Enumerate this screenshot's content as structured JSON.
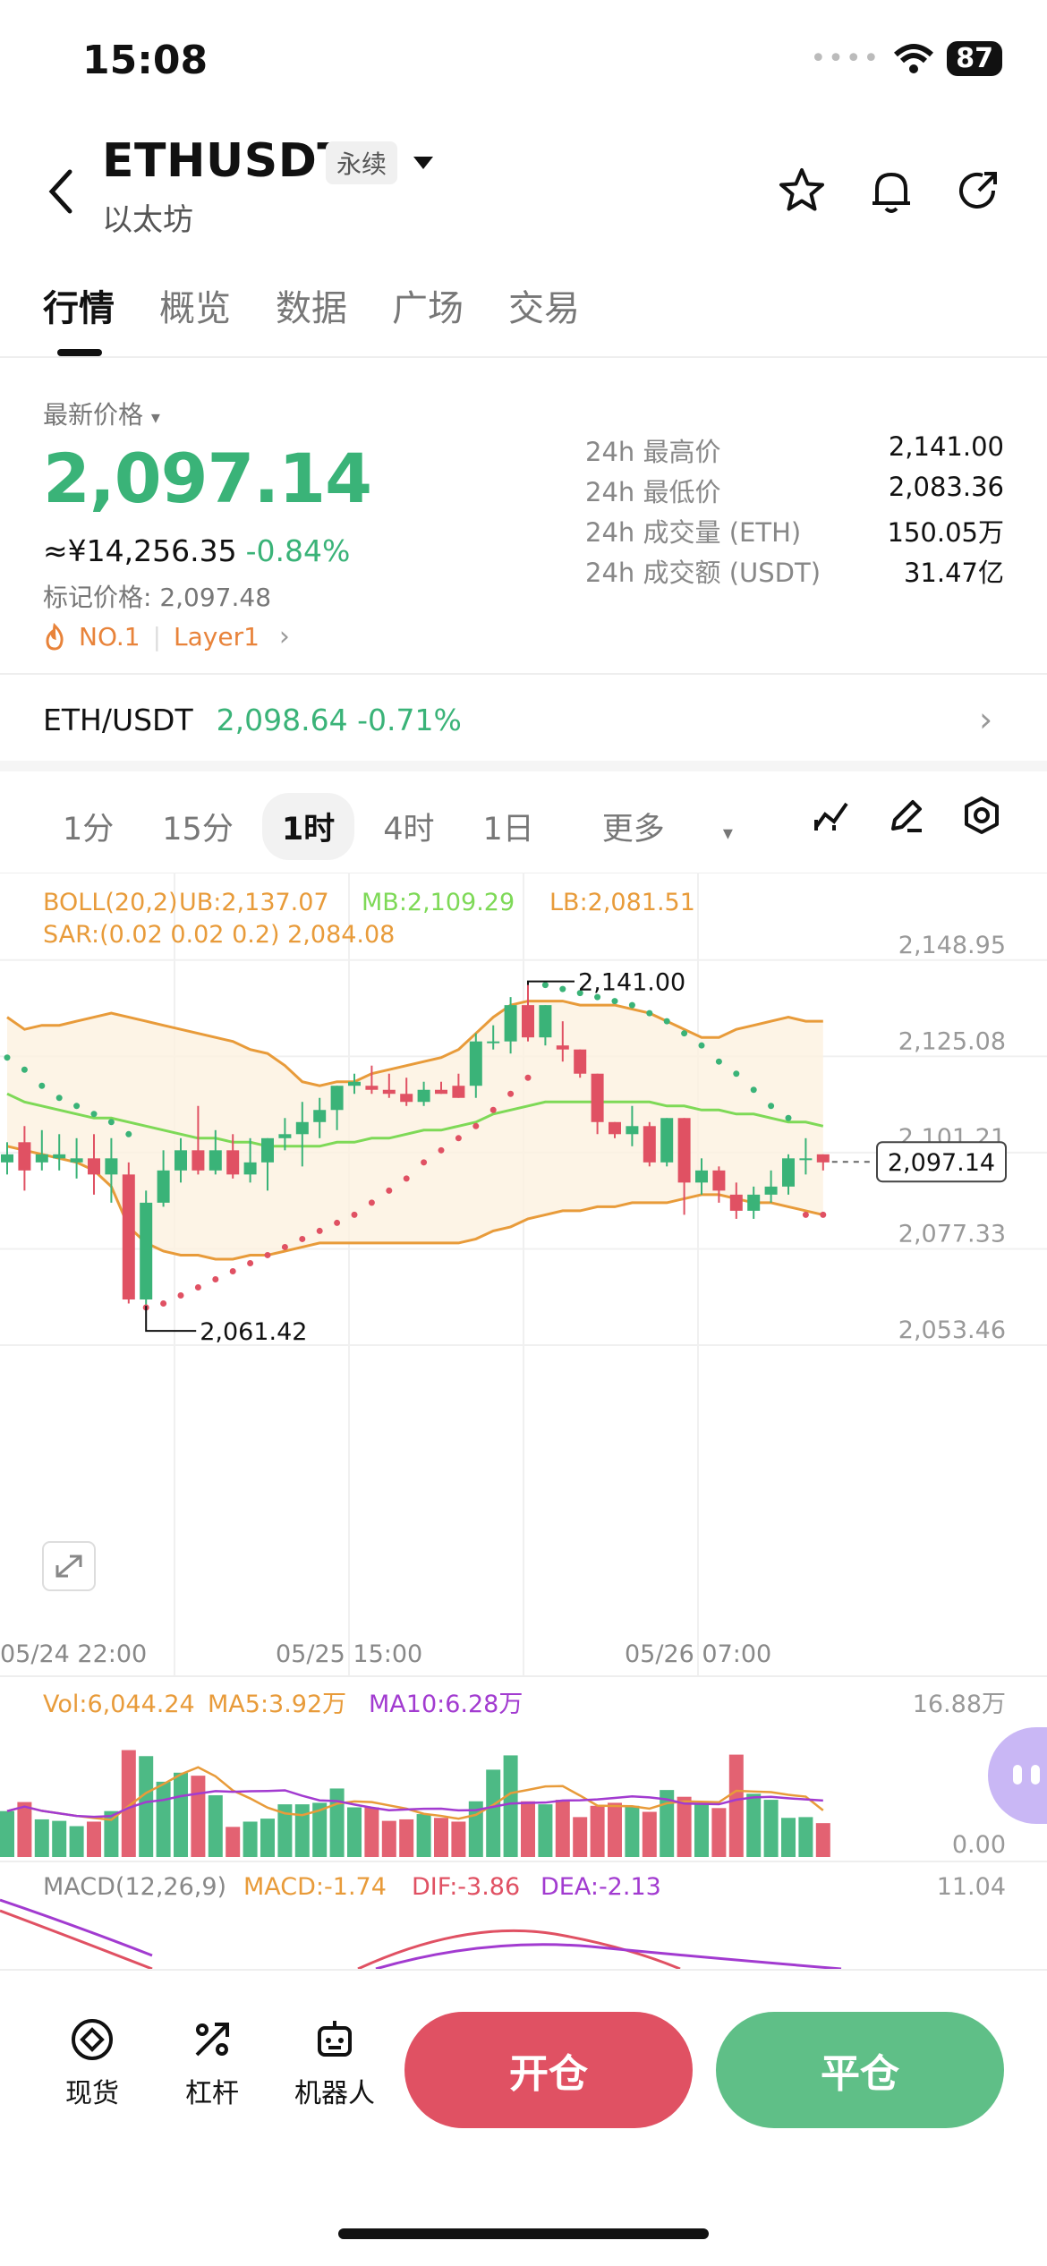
{
  "status": {
    "time": "15:08",
    "battery": "87"
  },
  "header": {
    "symbol": "ETHUSDT",
    "tag": "永续",
    "name": "以太坊"
  },
  "tabs": [
    {
      "label": "行情",
      "active": true
    },
    {
      "label": "概览",
      "active": false
    },
    {
      "label": "数据",
      "active": false
    },
    {
      "label": "广场",
      "active": false
    },
    {
      "label": "交易",
      "active": false
    }
  ],
  "price": {
    "label": "最新价格",
    "last": "2,097.14",
    "cny": "≈¥14,256.35",
    "change_pct": "-0.84%",
    "mark": "标记价格: 2,097.48",
    "rank": "NO.1",
    "category": "Layer1"
  },
  "stats": [
    {
      "k": "24h 最高价",
      "v": "2,141.00"
    },
    {
      "k": "24h 最低价",
      "v": "2,083.36"
    },
    {
      "k": "24h 成交量 (ETH)",
      "v": "150.05万"
    },
    {
      "k": "24h 成交额 (USDT)",
      "v": "31.47亿"
    }
  ],
  "spot_pair": {
    "name": "ETH/USDT",
    "price": "2,098.64",
    "change": "-0.71%"
  },
  "timeframes": [
    {
      "label": "1分",
      "active": false
    },
    {
      "label": "15分",
      "active": false
    },
    {
      "label": "1时",
      "active": true
    },
    {
      "label": "4时",
      "active": false
    },
    {
      "label": "1日",
      "active": false
    },
    {
      "label": "更多",
      "active": false
    }
  ],
  "colors": {
    "up": "#3ab378",
    "down": "#e05163",
    "boll": "#e89b3a",
    "mb": "#7ed957",
    "macd_purple": "#a23bd0",
    "dif": "#e05163"
  },
  "chart_data": {
    "type": "candlestick",
    "indicators": {
      "boll": "BOLL(20,2)",
      "ub": "UB:2,137.07",
      "mb": "MB:2,109.29",
      "lb": "LB:2,081.51",
      "sar": "SAR:(0.02 0.02 0.2) 2,084.08"
    },
    "y_ticks": [
      "2,148.95",
      "2,125.08",
      "2,101.21",
      "2,077.33",
      "2,053.46"
    ],
    "ylim": [
      2053.46,
      2160
    ],
    "x_ticks": [
      "05/24 22:00",
      "05/25 15:00",
      "05/26 07:00"
    ],
    "high_label": "2,141.00",
    "low_label": "2,061.42",
    "last_label": "2,097.14",
    "candles": [
      [
        2097,
        2099,
        2094,
        2102
      ],
      [
        2102,
        2095,
        2090,
        2106
      ],
      [
        2097,
        2099,
        2095,
        2105
      ],
      [
        2098,
        2099,
        2095,
        2104
      ],
      [
        2097,
        2098,
        2093,
        2103
      ],
      [
        2098,
        2094,
        2089,
        2104
      ],
      [
        2094,
        2098,
        2087,
        2103
      ],
      [
        2094,
        2063,
        2062,
        2097
      ],
      [
        2063,
        2087,
        2061,
        2090
      ],
      [
        2087,
        2095,
        2086,
        2100
      ],
      [
        2095,
        2100,
        2092,
        2103
      ],
      [
        2100,
        2095,
        2094,
        2111
      ],
      [
        2095,
        2100,
        2094,
        2105
      ],
      [
        2100,
        2094,
        2093,
        2104
      ],
      [
        2094,
        2097,
        2092,
        2103
      ],
      [
        2097,
        2103,
        2090,
        2103
      ],
      [
        2103,
        2104,
        2100,
        2108
      ],
      [
        2104,
        2107,
        2096,
        2112
      ],
      [
        2107,
        2110,
        2103,
        2113
      ],
      [
        2110,
        2116,
        2105,
        2116
      ],
      [
        2116,
        2117,
        2114,
        2119
      ],
      [
        2116,
        2115,
        2114,
        2121
      ],
      [
        2115,
        2114,
        2113,
        2119
      ],
      [
        2114,
        2112,
        2111,
        2118
      ],
      [
        2112,
        2115,
        2111,
        2117
      ],
      [
        2115,
        2114,
        2114,
        2117
      ],
      [
        2116,
        2113,
        2113,
        2119
      ],
      [
        2116,
        2127,
        2113,
        2129
      ],
      [
        2127,
        2127,
        2125,
        2131
      ],
      [
        2127,
        2136,
        2124,
        2138
      ],
      [
        2136,
        2128,
        2127,
        2141
      ],
      [
        2128,
        2136,
        2126,
        2136
      ],
      [
        2126,
        2125,
        2122,
        2132
      ],
      [
        2125,
        2119,
        2118,
        2125
      ],
      [
        2119,
        2107,
        2104,
        2119
      ],
      [
        2107,
        2104,
        2103,
        2107
      ],
      [
        2104,
        2106,
        2101,
        2111
      ],
      [
        2106,
        2097,
        2096,
        2107
      ],
      [
        2097,
        2108,
        2096,
        2108
      ],
      [
        2108,
        2092,
        2084,
        2108
      ],
      [
        2092,
        2095,
        2089,
        2098
      ],
      [
        2095,
        2090,
        2087,
        2096
      ],
      [
        2089,
        2085,
        2083,
        2092
      ],
      [
        2085,
        2089,
        2083,
        2091
      ],
      [
        2089,
        2091,
        2087,
        2095
      ],
      [
        2091,
        2098,
        2089,
        2099
      ],
      [
        2098,
        2098,
        2094,
        2103
      ],
      [
        2099,
        2097,
        2095,
        2099
      ]
    ],
    "ub_series": [
      2133,
      2130,
      2131,
      2131,
      2132,
      2133,
      2134,
      2133,
      2132,
      2131,
      2130,
      2129,
      2128,
      2127,
      2125,
      2124,
      2121,
      2117,
      2116,
      2117,
      2117,
      2119,
      2120,
      2121,
      2122,
      2123,
      2125,
      2129,
      2133,
      2136,
      2137,
      2137,
      2137,
      2136,
      2136,
      2136,
      2135,
      2134,
      2132,
      2130,
      2128,
      2128,
      2130,
      2131,
      2132,
      2133,
      2132,
      2132
    ],
    "mb_series": [
      2114,
      2112,
      2111,
      2110,
      2109,
      2108,
      2108,
      2107,
      2106,
      2105,
      2104,
      2103,
      2103,
      2102,
      2102,
      2101,
      2101,
      2101,
      2101,
      2102,
      2102,
      2103,
      2103,
      2104,
      2105,
      2105,
      2106,
      2107,
      2109,
      2110,
      2111,
      2112,
      2112,
      2112,
      2112,
      2112,
      2112,
      2112,
      2111,
      2111,
      2110,
      2110,
      2109,
      2109,
      2108,
      2107,
      2107,
      2106
    ],
    "lb_series": [
      2101,
      2100,
      2099,
      2098,
      2097,
      2095,
      2091,
      2081,
      2077,
      2075,
      2074,
      2074,
      2073,
      2073,
      2074,
      2074,
      2075,
      2076,
      2077,
      2077,
      2077,
      2077,
      2077,
      2077,
      2077,
      2077,
      2077,
      2078,
      2080,
      2081,
      2083,
      2084,
      2085,
      2085,
      2086,
      2086,
      2087,
      2087,
      2087,
      2088,
      2089,
      2089,
      2088,
      2087,
      2087,
      2086,
      2085,
      2084
    ],
    "sar_series": [
      2123,
      2120,
      2116,
      2113,
      2111,
      2109,
      2107,
      2104,
      2061,
      2062,
      2064,
      2066,
      2068,
      2070,
      2072,
      2074,
      2076,
      2078,
      2080,
      2082,
      2084,
      2087,
      2090,
      2093,
      2097,
      2100,
      2103,
      2106,
      2110,
      2114,
      2118,
      2141,
      2140,
      2139,
      2138,
      2137,
      2136,
      2134,
      2132,
      2129,
      2126,
      2122,
      2119,
      2115,
      2111,
      2108,
      2084,
      2084
    ],
    "volume": {
      "label": "Vol:6,044.24",
      "ma5": "MA5:3.92万",
      "ma10": "MA10:6.28万",
      "max_tick": "16.88万",
      "min_tick": "0.00",
      "values": [
        6.1,
        7.3,
        5.0,
        4.8,
        4.1,
        4.7,
        6.1,
        14.2,
        13.4,
        10.0,
        11.2,
        10.8,
        8.2,
        4.0,
        4.7,
        5.1,
        7.0,
        7.0,
        7.2,
        9.1,
        6.6,
        6.6,
        4.8,
        5.0,
        5.7,
        5.2,
        4.7,
        7.4,
        11.6,
        13.5,
        7.4,
        7.0,
        7.6,
        5.3,
        6.8,
        7.2,
        6.8,
        6.0,
        8.9,
        8.0,
        7.0,
        6.5,
        13.6,
        8.4,
        7.6,
        5.2,
        5.3,
        4.5
      ]
    },
    "macd": {
      "label": "MACD(12,26,9)",
      "macd": "MACD:-1.74",
      "dif": "DIF:-3.86",
      "dea": "DEA:-2.13",
      "top_tick": "11.04"
    }
  },
  "bottom_nav": [
    {
      "label": "现货"
    },
    {
      "label": "杠杆"
    },
    {
      "label": "机器人"
    }
  ],
  "actions": {
    "open": "开仓",
    "close": "平仓"
  }
}
